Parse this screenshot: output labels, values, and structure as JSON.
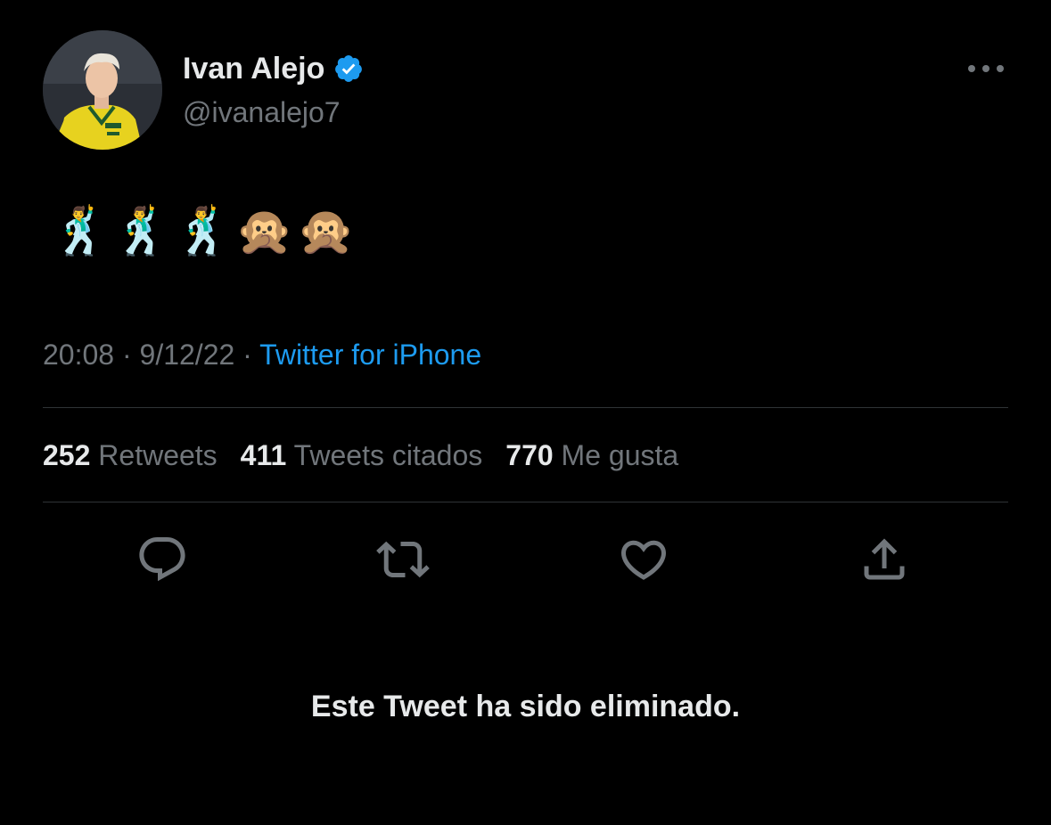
{
  "author": {
    "display_name": "Ivan Alejo",
    "handle": "@ivanalejo7",
    "verified": true,
    "avatar_icon": "player-photo"
  },
  "tweet": {
    "text": "🕺🕺🕺🙊🙊",
    "time": "20:08",
    "date": "9/12/22",
    "separator": "·",
    "source": "Twitter for iPhone"
  },
  "stats": {
    "retweets_count": "252",
    "retweets_label": "Retweets",
    "quotes_count": "411",
    "quotes_label": "Tweets citados",
    "likes_count": "770",
    "likes_label": "Me gusta"
  },
  "actions": {
    "reply_icon": "reply-icon",
    "retweet_icon": "retweet-icon",
    "like_icon": "heart-icon",
    "share_icon": "share-icon"
  },
  "status_message": "Este Tweet ha sido eliminado.",
  "colors": {
    "background": "#000000",
    "primary_text": "#e7e9ea",
    "secondary_text": "#71767b",
    "accent": "#1d9bf0",
    "divider": "#2f3336"
  }
}
